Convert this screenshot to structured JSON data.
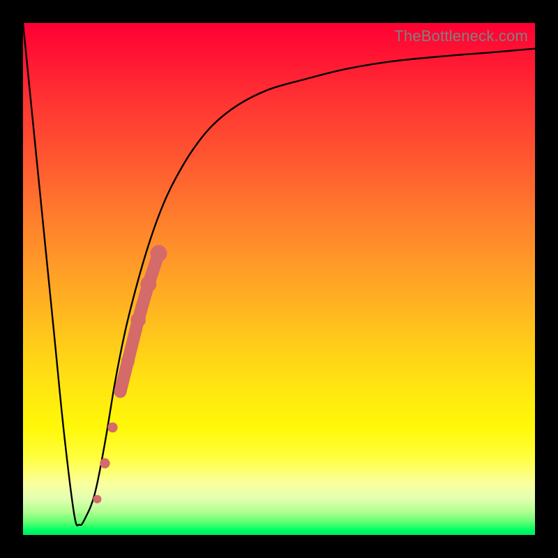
{
  "watermark": "TheBottleneck.com",
  "chart_data": {
    "type": "line",
    "title": "",
    "xlabel": "",
    "ylabel": "",
    "xlim": [
      0,
      100
    ],
    "ylim": [
      0,
      100
    ],
    "grid": false,
    "series": [
      {
        "name": "bottleneck-curve",
        "color": "#000000",
        "x": [
          0,
          3,
          6,
          8,
          10,
          11,
          12,
          14,
          16,
          18,
          20,
          22,
          24,
          26,
          28,
          30,
          33,
          37,
          42,
          48,
          55,
          63,
          72,
          82,
          92,
          100
        ],
        "y": [
          100,
          70,
          40,
          20,
          4,
          2,
          3,
          8,
          18,
          30,
          40,
          48,
          55,
          61,
          66,
          70,
          75,
          80,
          84,
          87,
          89,
          91,
          92.5,
          93.5,
          94.3,
          95
        ]
      },
      {
        "name": "highlight-dots",
        "color": "#d46a6a",
        "type": "scatter",
        "points": [
          {
            "x": 14.5,
            "y": 7,
            "r": 1.0
          },
          {
            "x": 16.0,
            "y": 14,
            "r": 1.2
          },
          {
            "x": 17.5,
            "y": 21,
            "r": 1.2
          },
          {
            "x": 19.0,
            "y": 28,
            "r": 1.4
          },
          {
            "x": 20.5,
            "y": 34,
            "r": 1.6
          },
          {
            "x": 22.5,
            "y": 42,
            "r": 1.8
          },
          {
            "x": 24.5,
            "y": 49,
            "r": 1.9
          },
          {
            "x": 26.5,
            "y": 55,
            "r": 2.0
          }
        ]
      }
    ],
    "gradient_scale": {
      "description": "vertical background gradient, value 0 = green (best), value 100 = red (worst)",
      "stops": [
        {
          "pos": 0,
          "color": "#00e860"
        },
        {
          "pos": 5,
          "color": "#60ff70"
        },
        {
          "pos": 10,
          "color": "#e0ffb0"
        },
        {
          "pos": 15,
          "color": "#ffff40"
        },
        {
          "pos": 30,
          "color": "#ffd018"
        },
        {
          "pos": 50,
          "color": "#ff9a28"
        },
        {
          "pos": 75,
          "color": "#ff5530"
        },
        {
          "pos": 100,
          "color": "#ff0033"
        }
      ]
    }
  }
}
